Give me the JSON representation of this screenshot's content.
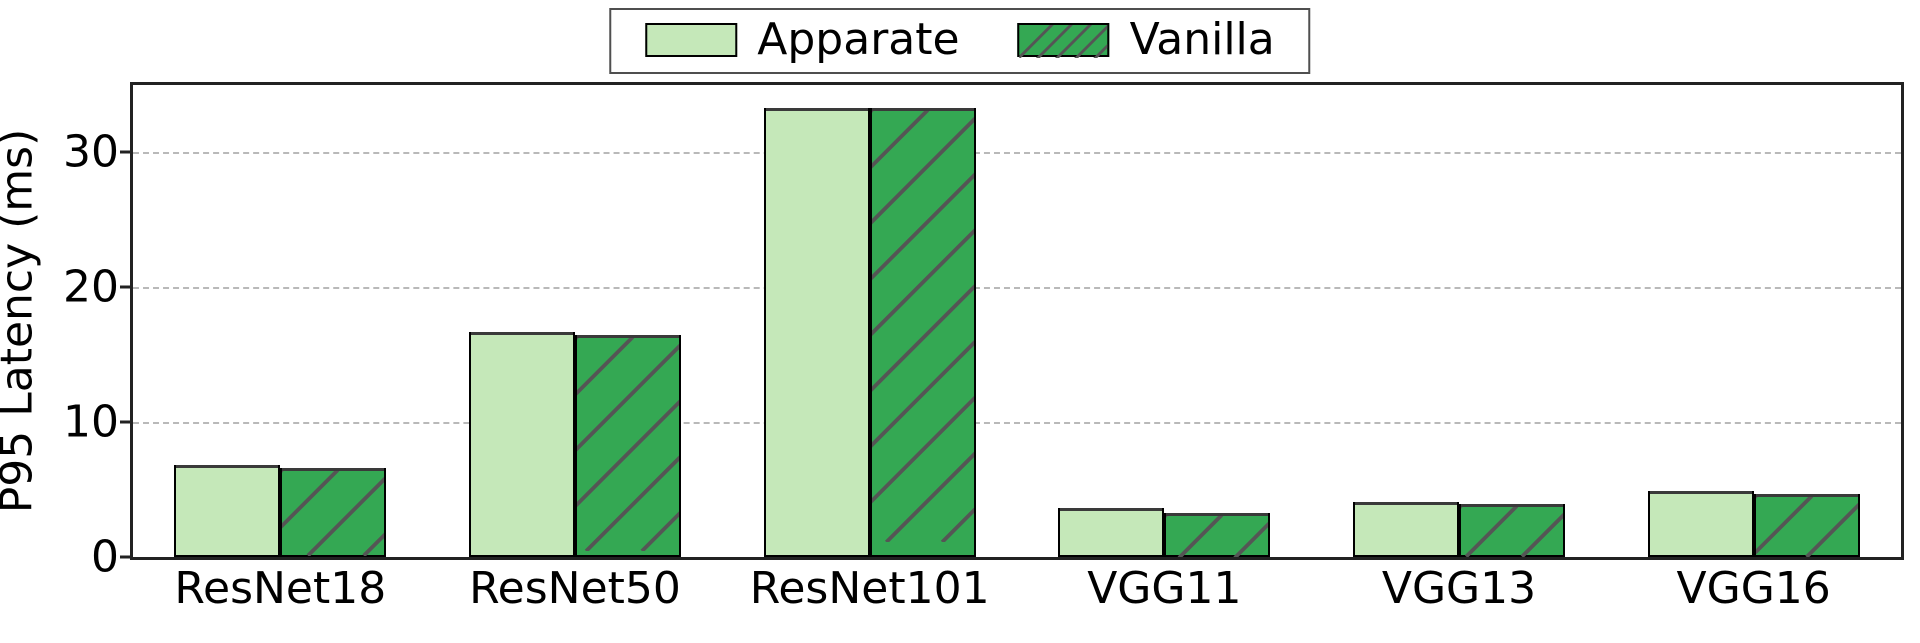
{
  "chart_data": {
    "type": "bar",
    "ylabel": "P95 Latency (ms)",
    "xlabel": "",
    "ylim": [
      0,
      35
    ],
    "yticks": [
      0,
      10,
      20,
      30
    ],
    "categories": [
      "ResNet18",
      "ResNet50",
      "ResNet101",
      "VGG11",
      "VGG13",
      "VGG16"
    ],
    "series": [
      {
        "name": "Apparate",
        "values": [
          6.8,
          16.7,
          33.3,
          3.6,
          4.1,
          4.9
        ]
      },
      {
        "name": "Vanilla",
        "values": [
          6.6,
          16.5,
          33.3,
          3.3,
          3.9,
          4.7
        ]
      }
    ],
    "legend_position": "top",
    "grid": true,
    "colors": {
      "apparate_fill": "#c5e8b9",
      "vanilla_fill": "#34a853",
      "edge": "#000000",
      "grid": "#b9b9b9",
      "hatch": "#555555"
    },
    "hatch": {
      "series": "Vanilla",
      "pattern": "forward-diagonal"
    }
  }
}
